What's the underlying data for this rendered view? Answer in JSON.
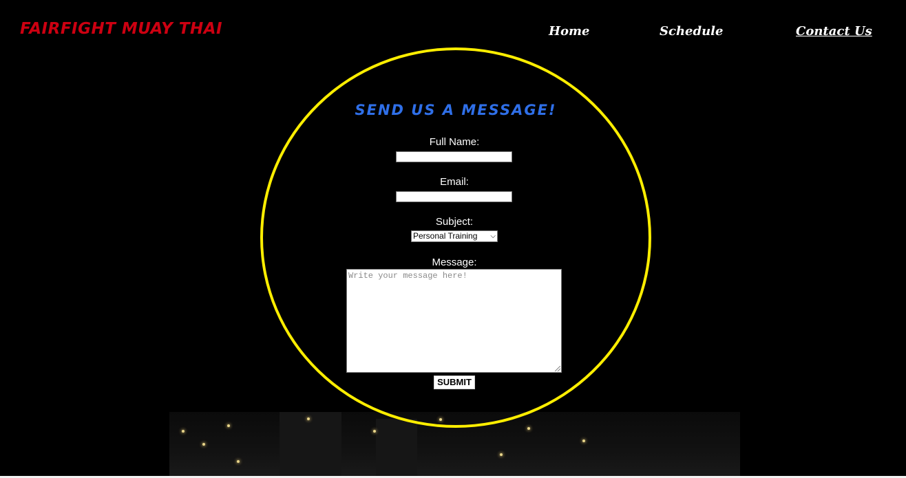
{
  "header": {
    "brand": "FAIRFIGHT MUAY THAI",
    "nav": {
      "home": "Home",
      "schedule": "Schedule",
      "contact": "Contact Us"
    }
  },
  "form": {
    "title": "SEND US A MESSAGE!",
    "full_name_label": "Full Name:",
    "full_name_value": "",
    "email_label": "Email:",
    "email_value": "",
    "subject_label": "Subject:",
    "subject_selected": "Personal Training",
    "message_label": "Message:",
    "message_placeholder": "Write your message here!",
    "submit_label": "SUBMIT"
  },
  "colors": {
    "brand": "#cc0011",
    "title": "#2f6fe8",
    "circle_border": "#ffee00",
    "background": "#000000",
    "text": "#ffffff"
  }
}
